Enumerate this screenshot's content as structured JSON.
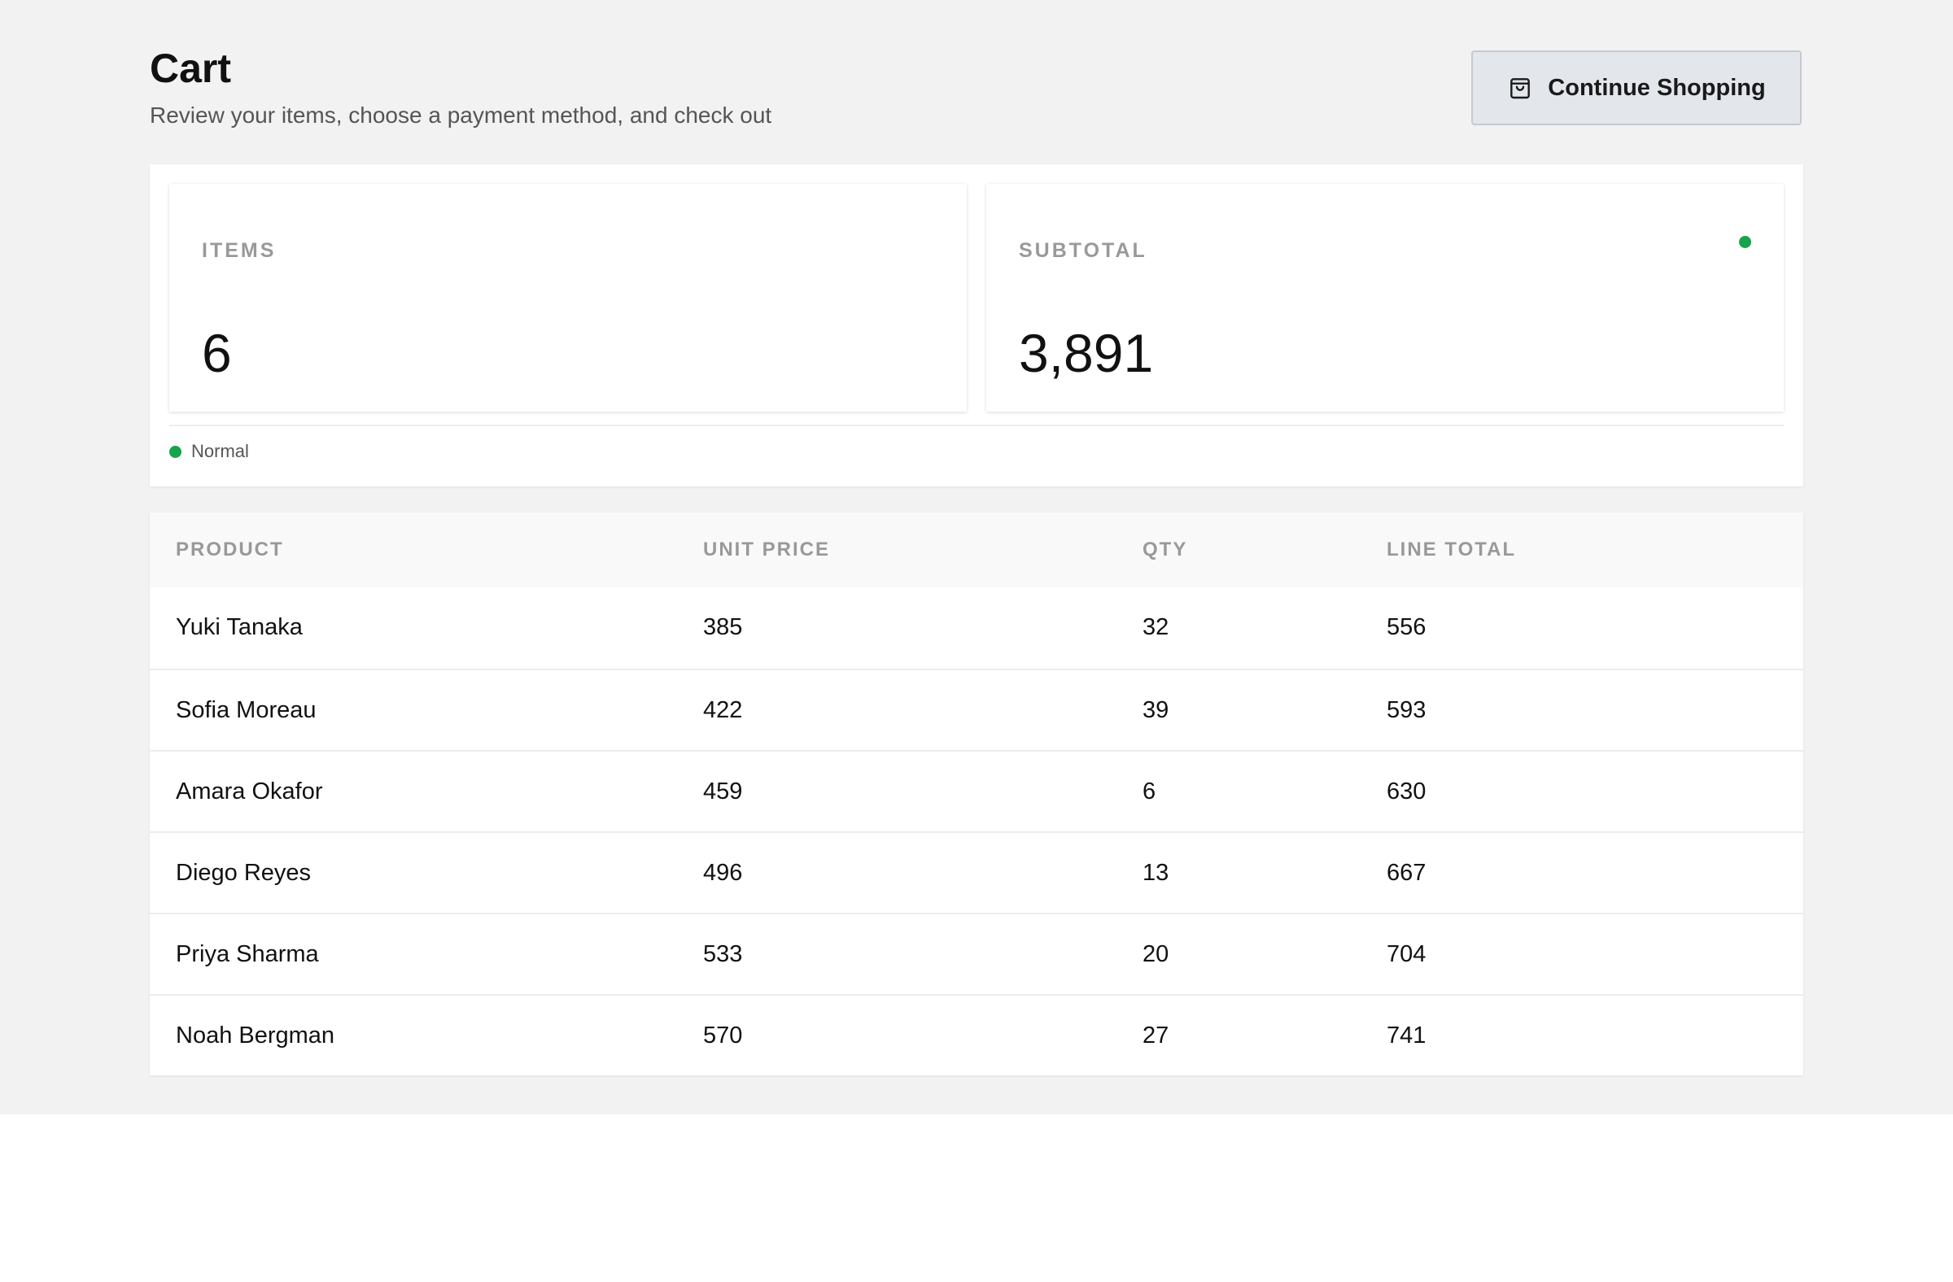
{
  "header": {
    "title": "Cart",
    "subtitle": "Review your items, choose a payment method, and check out"
  },
  "actions": {
    "continue_label": "Continue Shopping",
    "continue_icon": "shopping-bag-icon"
  },
  "summary": {
    "items_label": "ITEMS",
    "items_value": "6",
    "subtotal_label": "SUBTOTAL",
    "subtotal_value": "3,891",
    "status_color": "#16a34a",
    "legend_label": "Normal"
  },
  "table": {
    "columns": [
      "PRODUCT",
      "UNIT PRICE",
      "QTY",
      "LINE TOTAL"
    ],
    "rows": [
      {
        "product": "Yuki Tanaka",
        "unit_price": "385",
        "qty": "32",
        "line_total": "556"
      },
      {
        "product": "Sofia Moreau",
        "unit_price": "422",
        "qty": "39",
        "line_total": "593"
      },
      {
        "product": "Amara Okafor",
        "unit_price": "459",
        "qty": "6",
        "line_total": "630"
      },
      {
        "product": "Diego Reyes",
        "unit_price": "496",
        "qty": "13",
        "line_total": "667"
      },
      {
        "product": "Priya Sharma",
        "unit_price": "533",
        "qty": "20",
        "line_total": "704"
      },
      {
        "product": "Noah Bergman",
        "unit_price": "570",
        "qty": "27",
        "line_total": "741"
      }
    ]
  }
}
